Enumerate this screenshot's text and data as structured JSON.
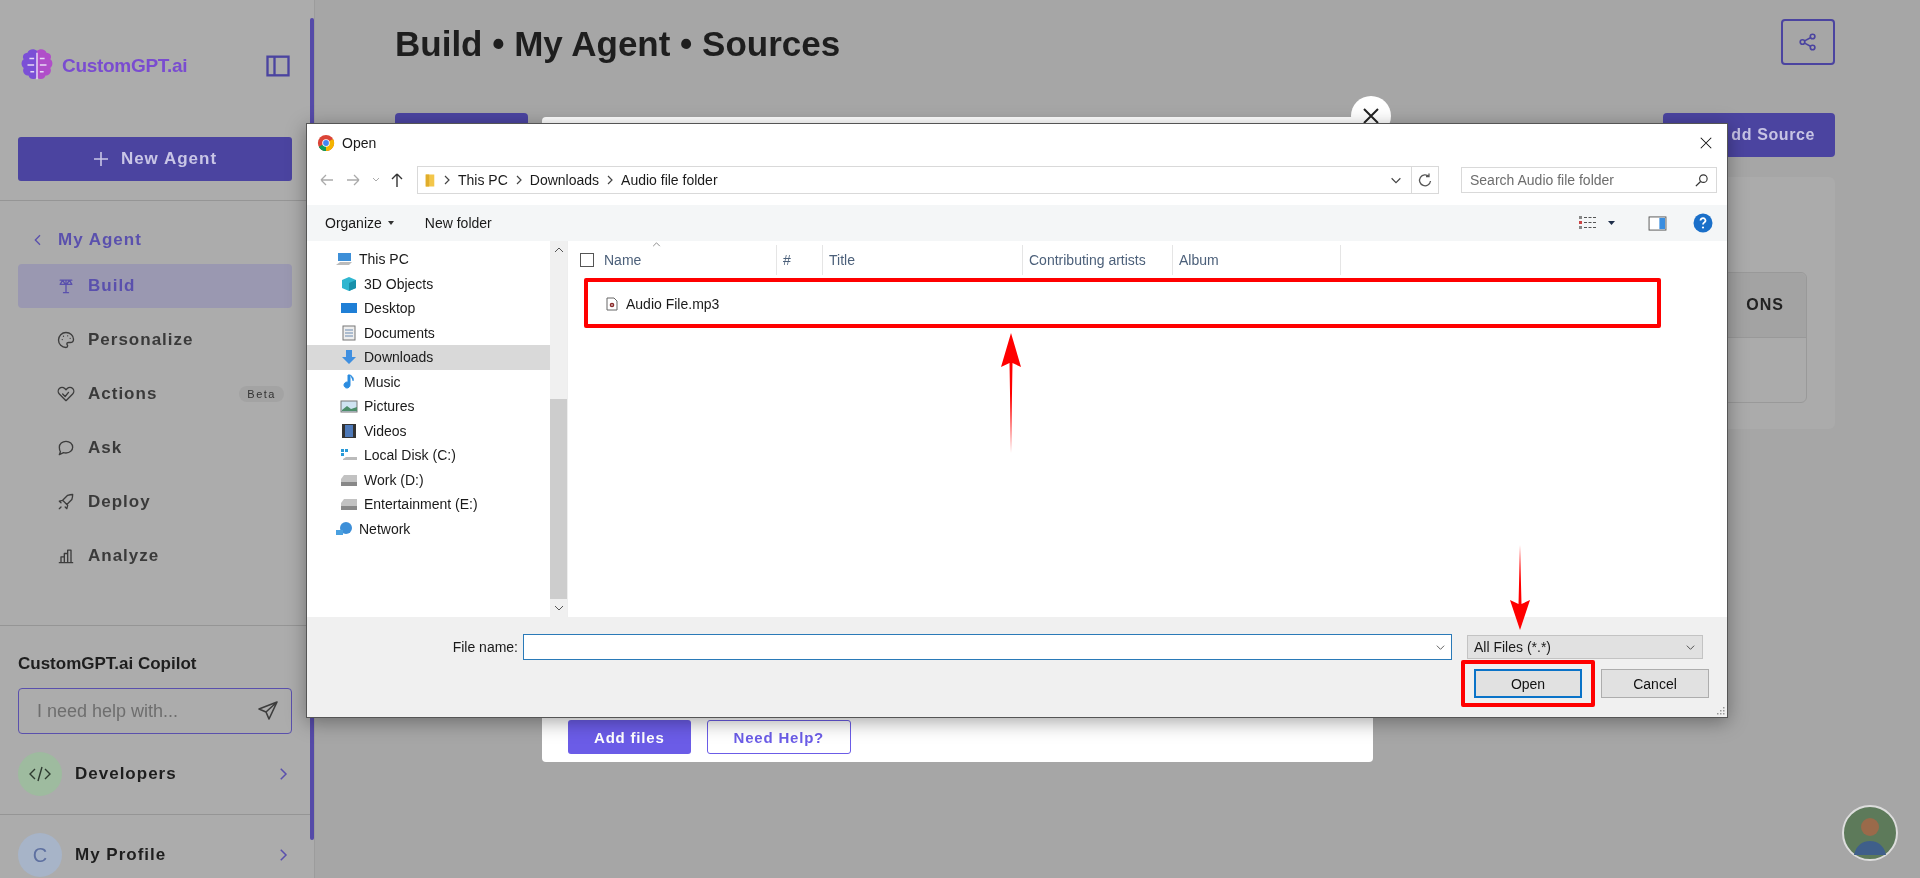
{
  "sidebar": {
    "brand": "CustomGPT.ai",
    "new_agent": "New Agent",
    "back": "My Agent",
    "items": [
      {
        "label": "Build",
        "kind": "build",
        "selected": true
      },
      {
        "label": "Personalize",
        "kind": "palette",
        "selected": false
      },
      {
        "label": "Actions",
        "kind": "actions",
        "selected": false,
        "badge": "Beta"
      },
      {
        "label": "Ask",
        "kind": "ask",
        "selected": false
      },
      {
        "label": "Deploy",
        "kind": "deploy",
        "selected": false
      },
      {
        "label": "Analyze",
        "kind": "analyze",
        "selected": false
      }
    ],
    "copilot": {
      "title": "CustomGPT.ai Copilot",
      "placeholder": "I need help with..."
    },
    "links": [
      {
        "label": "Developers",
        "kind": "code"
      },
      {
        "label": "My Profile",
        "kind": "profile",
        "initial": "C"
      }
    ]
  },
  "page": {
    "title": "Build • My Agent • Sources",
    "add_source": "dd Source",
    "table_header": "ONS"
  },
  "upload_modal": {
    "buttons": [
      {
        "label": "Add files",
        "kind": "primary"
      },
      {
        "label": "Need Help?",
        "kind": "outline"
      }
    ]
  },
  "dialog": {
    "title": "Open",
    "path": [
      "This PC",
      "Downloads",
      "Audio file folder"
    ],
    "search_placeholder": "Search Audio file folder",
    "toolbar": [
      {
        "label": "Organize",
        "menu": true
      },
      {
        "label": "New folder",
        "menu": false
      }
    ],
    "nav": [
      {
        "label": "This PC",
        "kind": "pc",
        "selected": false,
        "children": [
          {
            "label": "3D Objects",
            "kind": "cube",
            "selected": false
          },
          {
            "label": "Desktop",
            "kind": "desktop",
            "selected": false
          },
          {
            "label": "Documents",
            "kind": "documents",
            "selected": false
          },
          {
            "label": "Downloads",
            "kind": "downloads",
            "selected": true
          },
          {
            "label": "Music",
            "kind": "music",
            "selected": false
          },
          {
            "label": "Pictures",
            "kind": "pictures",
            "selected": false
          },
          {
            "label": "Videos",
            "kind": "videos",
            "selected": false
          },
          {
            "label": "Local Disk (C:)",
            "kind": "system",
            "selected": false
          },
          {
            "label": "Work (D:)",
            "kind": "drive",
            "selected": false
          },
          {
            "label": "Entertainment (E:)",
            "kind": "drive",
            "selected": false
          }
        ]
      },
      {
        "label": "Network",
        "kind": "network",
        "selected": false
      }
    ],
    "columns": [
      "Name",
      "#",
      "Title",
      "Contributing artists",
      "Album"
    ],
    "select_all": {
      "checked": false
    },
    "files": [
      {
        "name": "Audio File.mp3",
        "highlighted": true
      }
    ],
    "file_name_label": "File name:",
    "filter": "All Files (*.*)",
    "buttons": [
      {
        "label": "Open",
        "kind": "primary",
        "highlighted": true
      },
      {
        "label": "Cancel",
        "kind": "secondary",
        "highlighted": false
      }
    ]
  }
}
